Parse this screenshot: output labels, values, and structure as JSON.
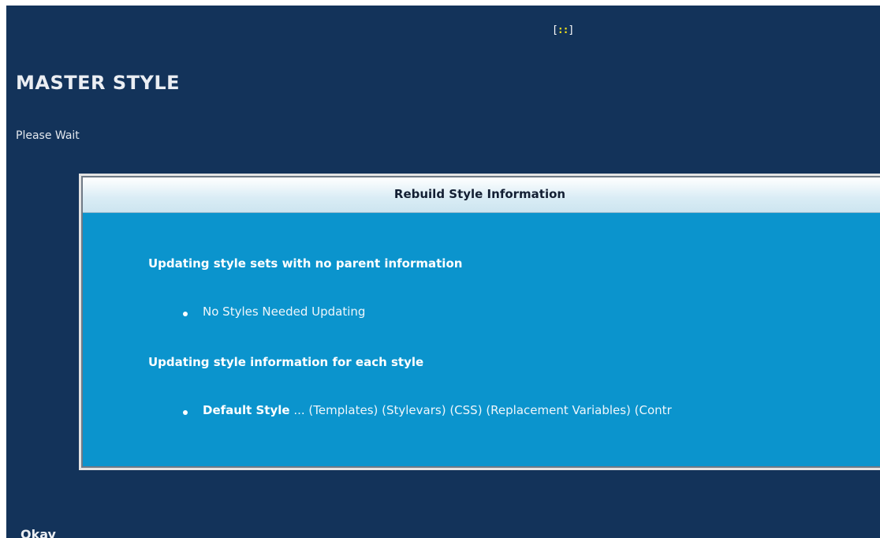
{
  "top_marker": {
    "open": "[",
    "dots": "::",
    "close": "]"
  },
  "page": {
    "title": "MASTER STYLE",
    "status": "Please Wait"
  },
  "panel": {
    "title": "Rebuild Style Information",
    "sections": [
      {
        "heading": "Updating style sets with no parent information",
        "bullet": "No Styles Needed Updating"
      },
      {
        "heading": "Updating style information for each style",
        "bullet_bold": "Default Style",
        "bullet_rest": " ... (Templates) (Stylevars) (CSS) (Replacement Variables) (Contr"
      }
    ]
  },
  "footer": {
    "text": "Okay"
  },
  "colors": {
    "background": "#13335a",
    "panel_body": "#0b94cd",
    "accent": "#f6e21a"
  }
}
